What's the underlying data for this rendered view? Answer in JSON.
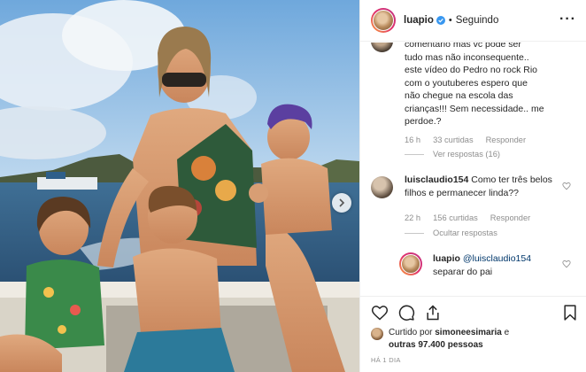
{
  "post_header": {
    "username": "luapio",
    "separator": "•",
    "follow_status": "Seguindo"
  },
  "comments": [
    {
      "text_lines": [
        "comentário mas vc pode ser",
        "tudo mas não inconsequente..",
        "este vídeo do Pedro no rock Rio",
        "com o youtuberes espero que",
        "não chegue na escola das",
        "crianças!!! Sem necessidade.. me",
        "perdoe.?"
      ],
      "time": "16 h",
      "likes": "33 curtidas",
      "reply_label": "Responder",
      "replies_toggle": "Ver respostas (16)"
    },
    {
      "username": "luisclaudio154",
      "text": "Como ter três belos filhos e permanecer linda??",
      "time": "22 h",
      "likes": "156 curtidas",
      "reply_label": "Responder",
      "replies_toggle": "Ocultar respostas"
    },
    {
      "username": "luapio",
      "mention": "@luisclaudio154",
      "text": "separar do pai"
    }
  ],
  "likes_summary": {
    "prefix": "Curtido por",
    "user": "simoneesimaria",
    "middle": "e",
    "others": "outras 97.400 pessoas"
  },
  "time_ago": "HÁ 1 DIA",
  "icons": [
    "verified-icon",
    "more-options-icon",
    "heart-icon",
    "comment-icon",
    "share-icon",
    "bookmark-icon",
    "carousel-next-icon"
  ],
  "colors": {
    "verified": "#3897f0",
    "muted": "#8e8e8e",
    "text": "#262626",
    "border": "#efefef"
  }
}
